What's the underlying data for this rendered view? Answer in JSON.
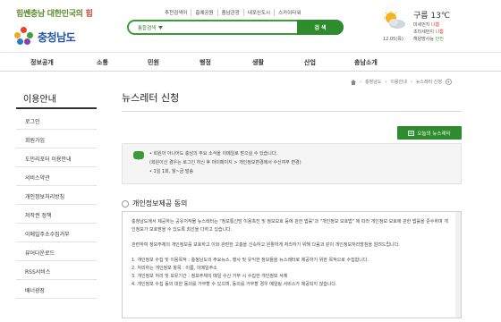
{
  "header": {
    "slogan_part1": "힘쎈충남",
    "slogan_part2": " 대한민국의 ",
    "slogan_part3": "힘",
    "logo_text": "충청남도",
    "top_links": [
      "추천검색어",
      "홍예공원",
      "충남관광",
      "내포신도시",
      "스카이타워"
    ],
    "search": {
      "category": "통합검색",
      "placeholder": "",
      "button_label": "검 색"
    },
    "weather": {
      "city_temp": "구름 13℃",
      "date": "12.05(목)",
      "rows": [
        {
          "label": "미세먼지",
          "value": "나쁨",
          "level": "bad"
        },
        {
          "label": "초미세먼지",
          "value": "나쁨",
          "level": "bad"
        },
        {
          "label": "해양방사능",
          "value": "안전",
          "level": "good"
        }
      ]
    }
  },
  "nav": {
    "items": [
      "정보공개",
      "소통",
      "민원",
      "행정",
      "생활",
      "산업",
      "충남소개"
    ]
  },
  "sidebar": {
    "title": "이용안내",
    "items": [
      {
        "label": "로그인"
      },
      {
        "label": "회원가입"
      },
      {
        "label": "도민리포터 이용안내"
      },
      {
        "label": "서비스약관"
      },
      {
        "label": "개인정보처리방침"
      },
      {
        "label": "저작권 정책"
      },
      {
        "label": "이메일주소수집거부"
      },
      {
        "label": "뷰어다운로드"
      },
      {
        "label": "RSS서비스"
      },
      {
        "label": "배너광장"
      }
    ]
  },
  "breadcrumb": [
    "충청남도",
    "이용안내",
    "뉴스레터 신청"
  ],
  "page": {
    "title": "뉴스레터 신청",
    "today_news_button": "오늘의 뉴스레터"
  },
  "info_box": {
    "lines": [
      "• 회원이 아니어도 충남의 주요 소식을 이메일로 받으실 수 있습니다.",
      "(회원이신 경우는 로그인 하신 후 마이페이지 > 개인정보변경에서 수신여부 변경)",
      "• 1일 1회, 월~금 발송"
    ]
  },
  "consent": {
    "section_title": "개인정보제공 동의",
    "paragraph1": "충청남도에서 제공하는 공유저작물 뉴스레터는 \"정보통신망 이용촉진 및 정보보호 등에 관한 법률\"과 \"개인정보 보호법\" 에 따라 개인정보 보호에 관한 법률을 준수하며 개인정보가 보호받을 수 있도록 최선을 다하고 있습니다.",
    "paragraph2": "관련하여 정보주체의 개인정보를 보호하고 이와 관련한 고충을 신속하고 원활하게 처리하기 위해 다음과 같이 개인정보처리방침을 알려드립니다.",
    "list": [
      "1. 개인정보 수집 및 이용목적 : 충청남도의 주요뉴스, 행사 및 유익한 정보들을 뉴스레터로 제공하기 위한 목적으로 수집합니다.",
      "2. 처리하는 개인정보 항목 : 이름, 이메일주소",
      "3. 개인정보 처리 및 보유기간 : 정보주체의 메일 수신 거부 시 수집한 개인정보 삭제",
      "4. 개인정보 수집 동의 대한 동의를 거부할 수 있으며, 동의를 거부할 경우 메일링 서비스가 제공되지 않습니다."
    ]
  }
}
